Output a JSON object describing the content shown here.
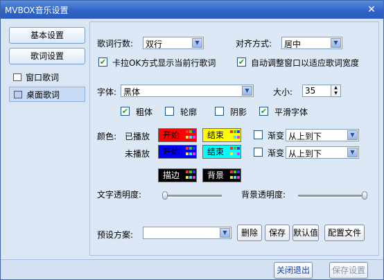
{
  "window": {
    "title": "MVBOX音乐设置",
    "close_label": "✕"
  },
  "sidebar": {
    "buttons": [
      {
        "label": "基本设置"
      },
      {
        "label": "歌词设置"
      }
    ],
    "items": [
      {
        "label": "窗口歌词",
        "icon": "document-icon"
      },
      {
        "label": "桌面歌词",
        "icon": "monitor-icon"
      }
    ]
  },
  "lyrics": {
    "lines_label": "歌词行数:",
    "lines_value": "双行",
    "align_label": "对齐方式:",
    "align_value": "居中",
    "karaoke_label": "卡拉OK方式显示当前行歌词",
    "autowidth_label": "自动调整窗口以适应歌词宽度"
  },
  "font": {
    "font_label": "字体:",
    "font_value": "黑体",
    "size_label": "大小:",
    "size_value": "35",
    "bold_label": "粗体",
    "outline_label": "轮廓",
    "shadow_label": "阴影",
    "smooth_label": "平滑字体",
    "bold_checked": true,
    "outline_checked": false,
    "shadow_checked": false,
    "smooth_checked": true
  },
  "colors": {
    "color_label": "颜色:",
    "played_label": "已播放",
    "unplayed_label": "未播放",
    "start_label": "开始",
    "end_label": "结束",
    "gradient_label": "渐变",
    "gradient_value": "从上到下",
    "stroke_label": "描边",
    "background_label": "背景",
    "played_start_color": "#ff0000",
    "played_end_color": "#ffff00",
    "unplayed_start_color": "#0000ff",
    "unplayed_end_color": "#00ffff",
    "stroke_color": "#000000",
    "background_color": "#000000"
  },
  "transparency": {
    "text_label": "文字透明度:",
    "bg_label": "背景透明度:",
    "text_level": 0,
    "bg_level": 100
  },
  "preset": {
    "label": "预设方案:",
    "value": "",
    "delete_label": "删除",
    "save_label": "保存",
    "default_label": "默认值",
    "config_label": "配置文件"
  },
  "footer": {
    "close_exit_label": "关闭退出",
    "save_settings_label": "保存设置"
  }
}
